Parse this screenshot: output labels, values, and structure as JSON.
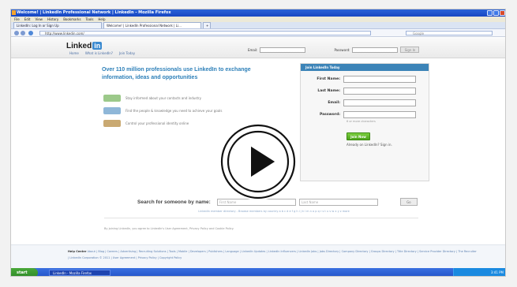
{
  "browser": {
    "window_title": "Welcome! | LinkedIn Professional Network | LinkedIn - Mozilla Firefox",
    "menu": [
      "File",
      "Edit",
      "View",
      "History",
      "Bookmarks",
      "Tools",
      "Help"
    ],
    "tabs": [
      "LinkedIn: Log In or Sign Up",
      "Welcome! | LinkedIn Professional Network | Li..."
    ],
    "url": "http://www.linkedin.com/",
    "search_placeholder": "Google"
  },
  "header": {
    "logo_text": "Linked",
    "logo_badge": "in",
    "nav": [
      "Home",
      "What is LinkedIn?",
      "Join Today"
    ],
    "email_label": "Email:",
    "password_label": "Password:",
    "signin_label": "Sign In"
  },
  "main": {
    "headline": "Over 110 million professionals use LinkedIn to exchange information, ideas and opportunities",
    "features": [
      "Stay informed about your contacts and industry",
      "Find the people & knowledge you need to achieve your goals",
      "Control your professional identity online"
    ]
  },
  "join_form": {
    "title": "Join LinkedIn Today",
    "first_name_label": "First Name:",
    "last_name_label": "Last Name:",
    "email_label": "Email:",
    "password_label": "Password:",
    "password_note": "6 or more characters",
    "join_button": "Join Now",
    "already_text": "Already on LinkedIn? Sign in."
  },
  "people_search": {
    "label": "Search for someone by name:",
    "first_placeholder": "First Name",
    "last_placeholder": "Last Name",
    "go_button": "Go",
    "sub_text": "LinkedIn member directory - Browse members by country a b c d e f g h i j k l m n o p q r s t u v w x y z more"
  },
  "legal_text": "By joining LinkedIn, you agree to LinkedIn's User Agreement, Privacy Policy and Cookie Policy.",
  "footer": {
    "links_strong": "Help Center",
    "links": "About | Blog | Careers | Advertising | Recruiting Solutions | Tools | Mobile | Developers | Publishers | Language | LinkedIn Updates | LinkedIn Influencers | LinkedIn Jobs | Jobs Directory | Company Directory | Groups Directory | Title Directory | Service Provider Directory | The Recruiter | LinkedIn Corporation © 2011 | User Agreement | Privacy Policy | Copyright Policy"
  },
  "taskbar": {
    "start_label": "start",
    "task_item": "LinkedIn - Mozilla Firefox",
    "clock": "3:41 PM"
  },
  "colors": {
    "linkedin_blue": "#2c7fb8",
    "join_header": "#3c84b8",
    "join_button": "#5cb82a",
    "xp_titlebar": "#1f50c8"
  }
}
